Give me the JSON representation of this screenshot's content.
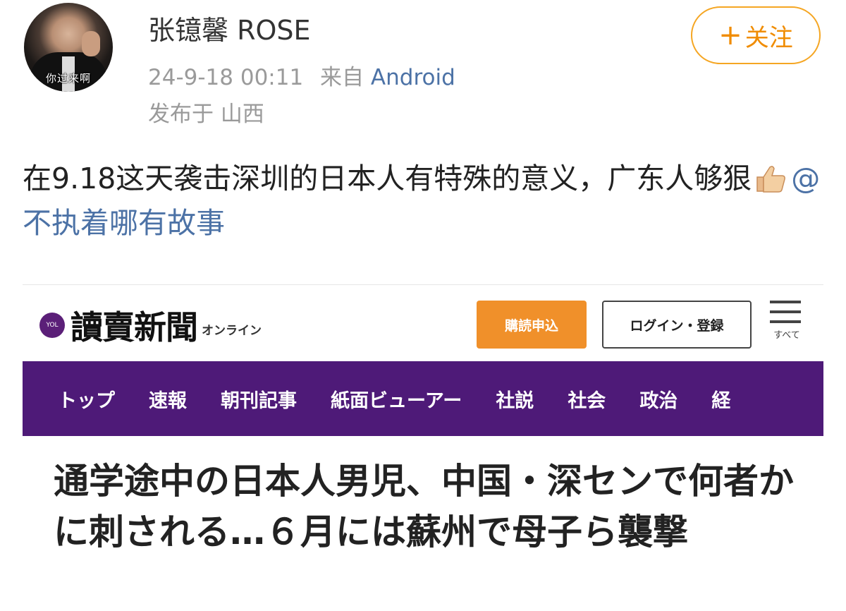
{
  "post": {
    "avatar_caption": "你过来啊",
    "username": "张镱馨 ROSE",
    "timestamp": "24-9-18 00:11",
    "source_prefix": "来自",
    "source_app": "Android",
    "location": "发布于 山西",
    "follow_plus": "+",
    "follow_label": "关注",
    "text_part1": "在9.18这天袭击深圳的日本人有特殊的意义，广东人够狠",
    "thumb_icon": "thumbs-up-icon",
    "mention": "@不执着哪有故事"
  },
  "news": {
    "logo_badge": "YOL",
    "logo_name": "讀賣新聞",
    "logo_suffix": "オンライン",
    "subscribe_label": "購読申込",
    "login_label": "ログイン・登録",
    "menu_label": "すべて",
    "nav": [
      "トップ",
      "速報",
      "朝刊記事",
      "紙面ビューアー",
      "社説",
      "社会",
      "政治",
      "経"
    ],
    "headline": "通学途中の日本人男児、中国・深センで何者かに刺される…６月には蘇州で母子ら襲撃"
  }
}
